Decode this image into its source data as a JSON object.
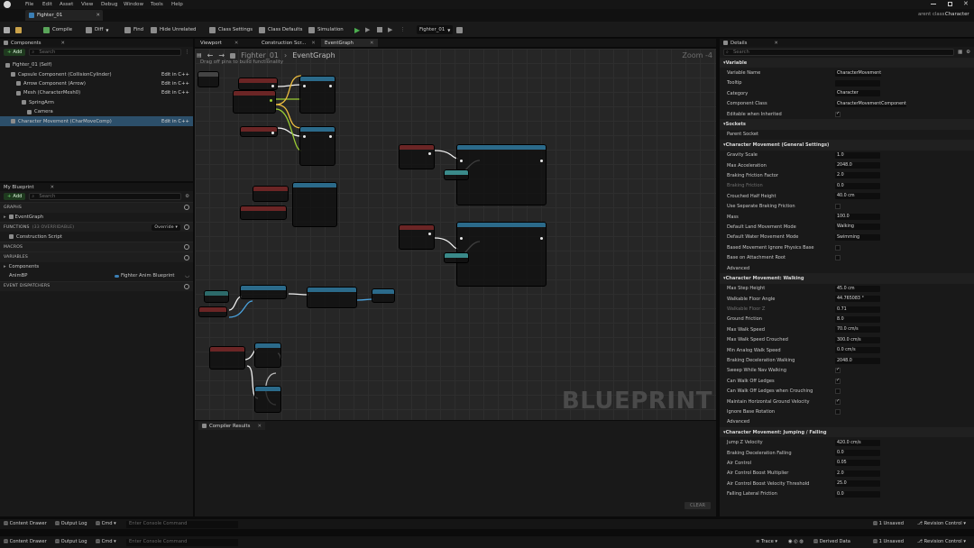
{
  "menu": [
    "File",
    "Edit",
    "Asset",
    "View",
    "Debug",
    "Window",
    "Tools",
    "Help"
  ],
  "asset_tab": "Fighter_01",
  "parent_class": {
    "label": "arent class:",
    "value": "Character"
  },
  "toolbar": {
    "compile": "Compile",
    "diff": "Diff",
    "find": "Find",
    "hide_unrelated": "Hide Unrelated",
    "class_settings": "Class Settings",
    "class_defaults": "Class Defaults",
    "simulation": "Simulation",
    "debug_object": "Fighter_01"
  },
  "components_panel": {
    "title": "Components",
    "add": "Add",
    "search": "Search",
    "tree": [
      {
        "label": "Fighter_01 (Self)",
        "indent": 0,
        "edit": ""
      },
      {
        "label": "Capsule Component (CollisionCylinder)",
        "indent": 1,
        "edit": "Edit in C++"
      },
      {
        "label": "Arrow Component (Arrow)",
        "indent": 2,
        "edit": "Edit in C++"
      },
      {
        "label": "Mesh (CharacterMesh0)",
        "indent": 2,
        "edit": "Edit in C++"
      },
      {
        "label": "SpringArm",
        "indent": 3,
        "edit": ""
      },
      {
        "label": "Camera",
        "indent": 4,
        "edit": ""
      },
      {
        "label": "Character Movement (CharMoveComp)",
        "indent": 1,
        "edit": "Edit in C++"
      }
    ]
  },
  "my_blueprint": {
    "title": "My Blueprint",
    "add": "Add",
    "search": "Search",
    "graphs": "GRAPHS",
    "event_graph": "EventGraph",
    "functions": "FUNCTIONS",
    "functions_count": "(33 OVERRIDABLE)",
    "override": "Override",
    "construction_script": "Construction Script",
    "macros": "MACROS",
    "variables": "VARIABLES",
    "components": "Components",
    "anim_var": "AnimBP",
    "anim_var_type": "Fighter Anim Blueprint",
    "event_dispatchers": "EVENT DISPATCHERS"
  },
  "graph_tabs": [
    "Viewport",
    "Construction Scr...",
    "EventGraph"
  ],
  "graph": {
    "breadcrumb_root": "Fighter_01",
    "breadcrumb_leaf": "EventGraph",
    "zoom": "Zoom -4",
    "hint": "Drag off pins to build functionality",
    "watermark": "BLUEPRINT"
  },
  "compiler": {
    "tab": "Compiler Results",
    "clear": "CLEAR"
  },
  "details": {
    "title": "Details",
    "search": "Search",
    "sections": [
      {
        "name": "Variable",
        "props": [
          {
            "label": "Variable Name",
            "value": "CharacterMovement",
            "kind": "text"
          },
          {
            "label": "Tooltip",
            "value": "",
            "kind": "text"
          },
          {
            "label": "Category",
            "value": "Character",
            "kind": "text"
          },
          {
            "label": "Component Class",
            "value": "CharacterMovementComponent",
            "kind": "text"
          },
          {
            "label": "Editable when Inherited",
            "value": "",
            "kind": "check_on"
          }
        ]
      },
      {
        "name": "Sockets",
        "props": [
          {
            "label": "Parent Socket",
            "value": "",
            "kind": "none"
          }
        ]
      },
      {
        "name": "Character Movement (General Settings)",
        "props": [
          {
            "label": "Gravity Scale",
            "value": "1.0",
            "kind": "text"
          },
          {
            "label": "Max Acceleration",
            "value": "2048.0",
            "kind": "text"
          },
          {
            "label": "Braking Friction Factor",
            "value": "2.0",
            "kind": "text"
          },
          {
            "label": "Braking Friction",
            "value": "0.0",
            "kind": "text"
          },
          {
            "label": "Crouched Half Height",
            "value": "40.0 cm",
            "kind": "text"
          },
          {
            "label": "Use Separate Braking Friction",
            "value": "",
            "kind": "check_off"
          },
          {
            "label": "Mass",
            "value": "100.0",
            "kind": "text"
          },
          {
            "label": "Default Land Movement Mode",
            "value": "Walking",
            "kind": "text"
          },
          {
            "label": "Default Water Movement Mode",
            "value": "Swimming",
            "kind": "text"
          },
          {
            "label": "Based Movement Ignore Physics Base",
            "value": "",
            "kind": "check_off"
          },
          {
            "label": "Base on Attachment Root",
            "value": "",
            "kind": "check_off"
          },
          {
            "label": "Advanced",
            "value": "",
            "kind": "none"
          }
        ]
      },
      {
        "name": "Character Movement: Walking",
        "props": [
          {
            "label": "Max Step Height",
            "value": "45.0 cm",
            "kind": "text"
          },
          {
            "label": "Walkable Floor Angle",
            "value": "44.765083 °",
            "kind": "text"
          },
          {
            "label": "Walkable Floor Z",
            "value": "0.71",
            "kind": "text"
          },
          {
            "label": "Ground Friction",
            "value": "8.0",
            "kind": "text"
          },
          {
            "label": "Max Walk Speed",
            "value": "70.0 cm/s",
            "kind": "text"
          },
          {
            "label": "Max Walk Speed Crouched",
            "value": "300.0 cm/s",
            "kind": "text"
          },
          {
            "label": "Min Analog Walk Speed",
            "value": "0.0 cm/s",
            "kind": "text"
          },
          {
            "label": "Braking Deceleration Walking",
            "value": "2048.0",
            "kind": "text"
          },
          {
            "label": "Sweep While Nav Walking",
            "value": "",
            "kind": "check_on"
          },
          {
            "label": "Can Walk Off Ledges",
            "value": "",
            "kind": "check_on"
          },
          {
            "label": "Can Walk Off Ledges when Crouching",
            "value": "",
            "kind": "check_off"
          },
          {
            "label": "Maintain Horizontal Ground Velocity",
            "value": "",
            "kind": "check_on"
          },
          {
            "label": "Ignore Base Rotation",
            "value": "",
            "kind": "check_off"
          },
          {
            "label": "Advanced",
            "value": "",
            "kind": "none"
          }
        ]
      },
      {
        "name": "Character Movement: Jumping / Falling",
        "props": [
          {
            "label": "Jump Z Velocity",
            "value": "420.0 cm/s",
            "kind": "text"
          },
          {
            "label": "Braking Deceleration Falling",
            "value": "0.0",
            "kind": "text"
          },
          {
            "label": "Air Control",
            "value": "0.05",
            "kind": "text"
          },
          {
            "label": "Air Control Boost Multiplier",
            "value": "2.0",
            "kind": "text"
          },
          {
            "label": "Air Control Boost Velocity Threshold",
            "value": "25.0",
            "kind": "text"
          },
          {
            "label": "Falling Lateral Friction",
            "value": "0.0",
            "kind": "text"
          }
        ]
      }
    ]
  },
  "statusbar": {
    "content_drawer": "Content Drawer",
    "output_log": "Output Log",
    "cmd": "Cmd",
    "console": "Enter Console Command",
    "unsaved": "1 Unsaved",
    "revision": "Revision Control",
    "trace": "Trace",
    "derived": "Derived Data"
  },
  "colors": {
    "accent_select": "#2c4f6a",
    "exec_wire": "#f0f0f0",
    "event_node": "#6b2525",
    "func_node": "#2b6a8a",
    "play_green": "#4caf50"
  }
}
